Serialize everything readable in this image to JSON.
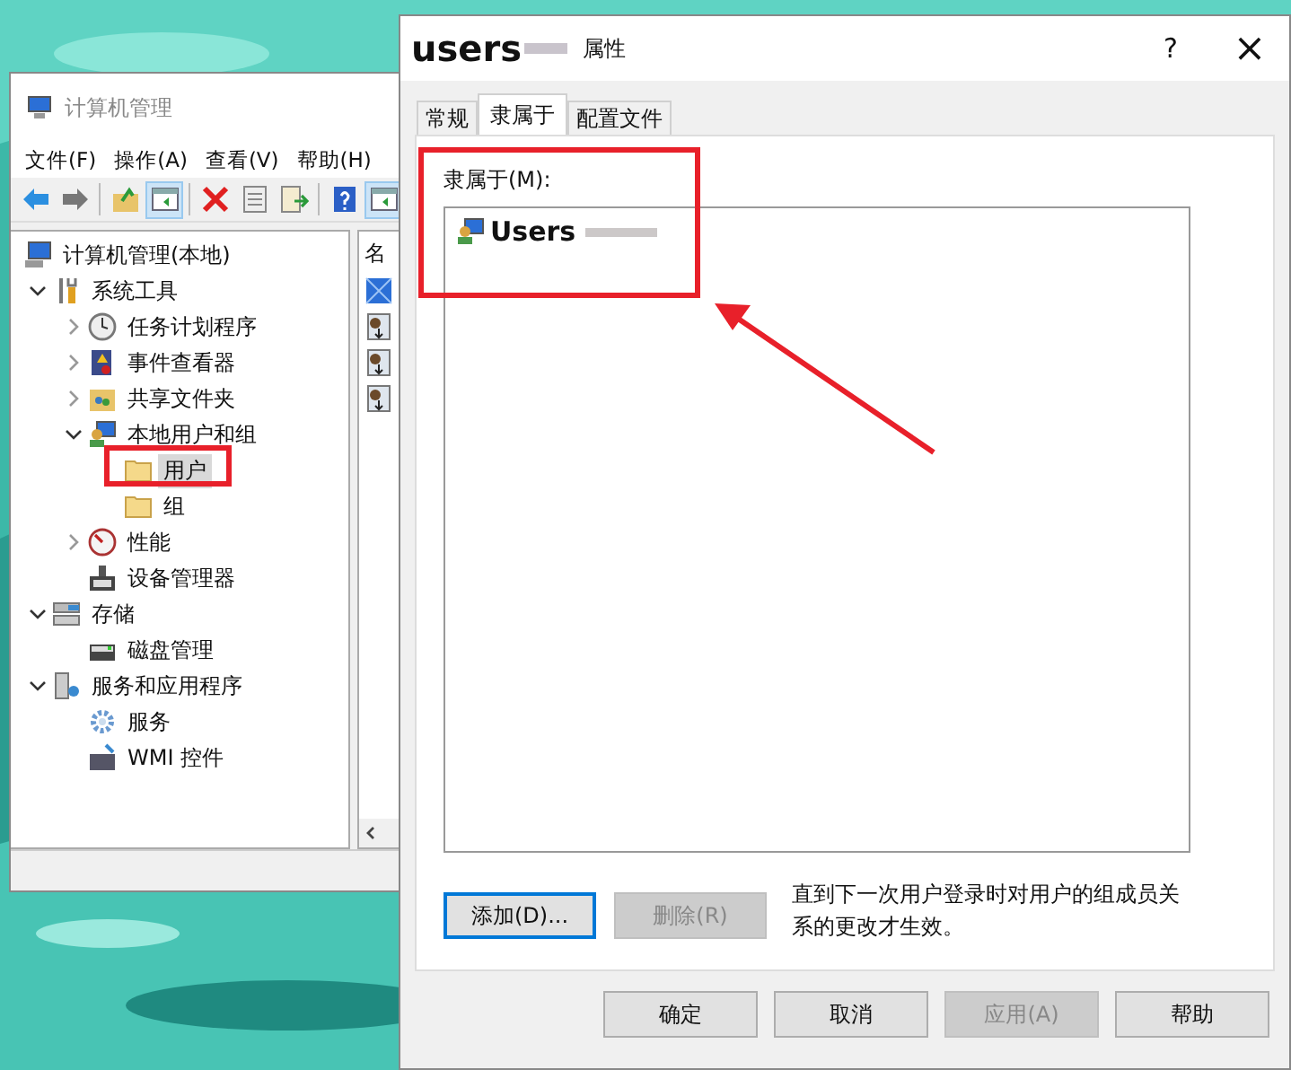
{
  "main_window": {
    "title": "计算机管理",
    "menu": [
      "文件(F)",
      "操作(A)",
      "查看(V)",
      "帮助(H)"
    ],
    "toolbar": [
      {
        "pressed": false
      },
      {
        "pressed": false
      },
      {
        "pressed": false
      },
      {
        "pressed": true
      },
      {
        "pressed": false
      },
      {
        "pressed": false
      },
      {
        "pressed": false
      },
      {
        "pressed": false
      },
      {
        "pressed": true
      }
    ],
    "tree": [
      {
        "label": "计算机管理(本地)",
        "selected": false,
        "children": [
          {
            "label": "系统工具",
            "expanded": true,
            "selected": false,
            "children": [
              {
                "label": "任务计划程序",
                "expanded": false,
                "selected": false
              },
              {
                "label": "事件查看器",
                "expanded": false,
                "selected": false
              },
              {
                "label": "共享文件夹",
                "expanded": false,
                "selected": false
              },
              {
                "label": "本地用户和组",
                "expanded": true,
                "selected": false,
                "children": [
                  {
                    "label": "用户",
                    "selected": true
                  },
                  {
                    "label": "组",
                    "selected": false
                  }
                ]
              },
              {
                "label": "性能",
                "expanded": false,
                "selected": false
              },
              {
                "label": "设备管理器",
                "selected": false
              }
            ]
          },
          {
            "label": "存储",
            "expanded": true,
            "selected": false,
            "children": [
              {
                "label": "磁盘管理",
                "selected": false
              }
            ]
          },
          {
            "label": "服务和应用程序",
            "expanded": true,
            "selected": false,
            "children": [
              {
                "label": "服务",
                "selected": false
              },
              {
                "label": "WMI 控件",
                "selected": false
              }
            ]
          }
        ]
      }
    ],
    "list_header": "名"
  },
  "dialog": {
    "title": "users",
    "title_suffix": "属性",
    "help_button": "?",
    "close_button": "×",
    "tabs": [
      {
        "label": "常规",
        "selected": false
      },
      {
        "label": "隶属于",
        "selected": true
      },
      {
        "label": "配置文件",
        "selected": false
      }
    ],
    "members_label": "隶属于(M):",
    "members": [
      {
        "name": "Users"
      }
    ],
    "buttons": [
      {
        "label": "添加(D)...",
        "disabled": false,
        "focused": true
      },
      {
        "label": "删除(R)",
        "disabled": true,
        "focused": false
      }
    ],
    "note": "直到下一次用户登录时对用户的组成员关系的更改才生效。",
    "footer_buttons": [
      {
        "label": "确定",
        "disabled": false
      },
      {
        "label": "取消",
        "disabled": false
      },
      {
        "label": "应用(A)",
        "disabled": true
      },
      {
        "label": "帮助",
        "disabled": false
      }
    ]
  },
  "annotations": [
    {
      "kind": "box"
    },
    {
      "kind": "box"
    },
    {
      "kind": "arrow"
    }
  ]
}
